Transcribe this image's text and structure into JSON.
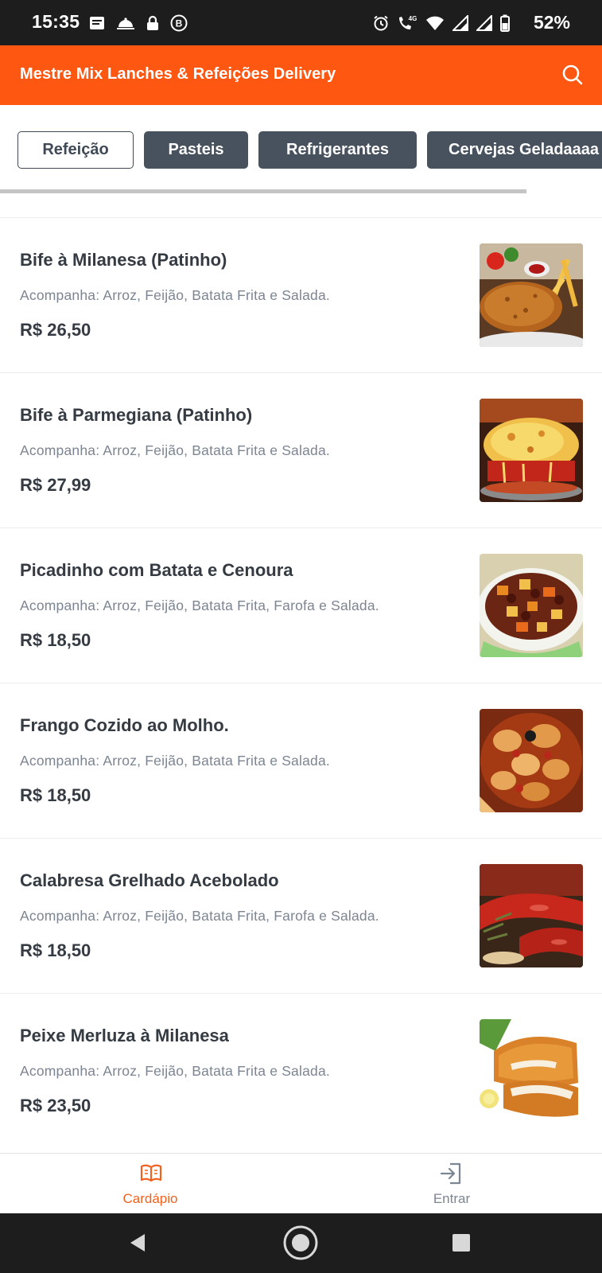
{
  "status_bar": {
    "time": "15:35",
    "battery": "52%",
    "network_label": "4G",
    "left_icons": [
      "notes-icon",
      "cloche-icon",
      "lock-icon",
      "b-badge-icon"
    ],
    "right_icons": [
      "alarm-icon",
      "phone-4g-icon",
      "wifi-icon",
      "signal-icon",
      "signal-icon-2",
      "battery-icon"
    ]
  },
  "header": {
    "title": "Mestre Mix Lanches & Refeições Delivery",
    "search_icon": "search-icon"
  },
  "categories": [
    {
      "label": "Refeição",
      "active": true
    },
    {
      "label": "Pasteis",
      "active": false
    },
    {
      "label": "Refrigerantes",
      "active": false
    },
    {
      "label": "Cervejas Geladaaaa",
      "active": false
    }
  ],
  "menu_items": [
    {
      "name": "Bife à Milanesa (Patinho)",
      "description": "Acompanha: Arroz, Feijão, Batata Frita e Salada.",
      "price": "R$ 26,50",
      "photo": "breaded-steak-photo"
    },
    {
      "name": "Bife à Parmegiana (Patinho)",
      "description": "Acompanha: Arroz, Feijão, Batata Frita e Salada.",
      "price": "R$ 27,99",
      "photo": "parmigiana-photo"
    },
    {
      "name": "Picadinho com Batata e Cenoura",
      "description": "Acompanha: Arroz, Feijão, Batata Frita, Farofa e Salada.",
      "price": "R$ 18,50",
      "photo": "beef-stew-photo"
    },
    {
      "name": "Frango Cozido ao Molho.",
      "description": "Acompanha: Arroz, Feijão, Batata Frita e Salada.",
      "price": "R$ 18,50",
      "photo": "chicken-stew-photo"
    },
    {
      "name": "Calabresa Grelhado Acebolado",
      "description": "Acompanha: Arroz, Feijão, Batata Frita, Farofa e Salada.",
      "price": "R$ 18,50",
      "photo": "grilled-sausage-photo"
    },
    {
      "name": "Peixe Merluza à Milanesa",
      "description": "Acompanha: Arroz, Feijão, Batata Frita e Salada.",
      "price": "R$ 23,50",
      "photo": "breaded-fish-photo"
    }
  ],
  "bottom_nav": [
    {
      "label": "Cardápio",
      "icon": "open-book-icon",
      "active": true
    },
    {
      "label": "Entrar",
      "icon": "login-icon",
      "active": false
    }
  ],
  "android_nav": [
    "back-icon",
    "home-icon",
    "recents-icon"
  ],
  "colors": {
    "brand_orange": "#fe5711",
    "tab_dark": "#47525e",
    "text_dark": "#353b43",
    "text_muted": "#7c8592",
    "active_nav": "#f2611e"
  }
}
